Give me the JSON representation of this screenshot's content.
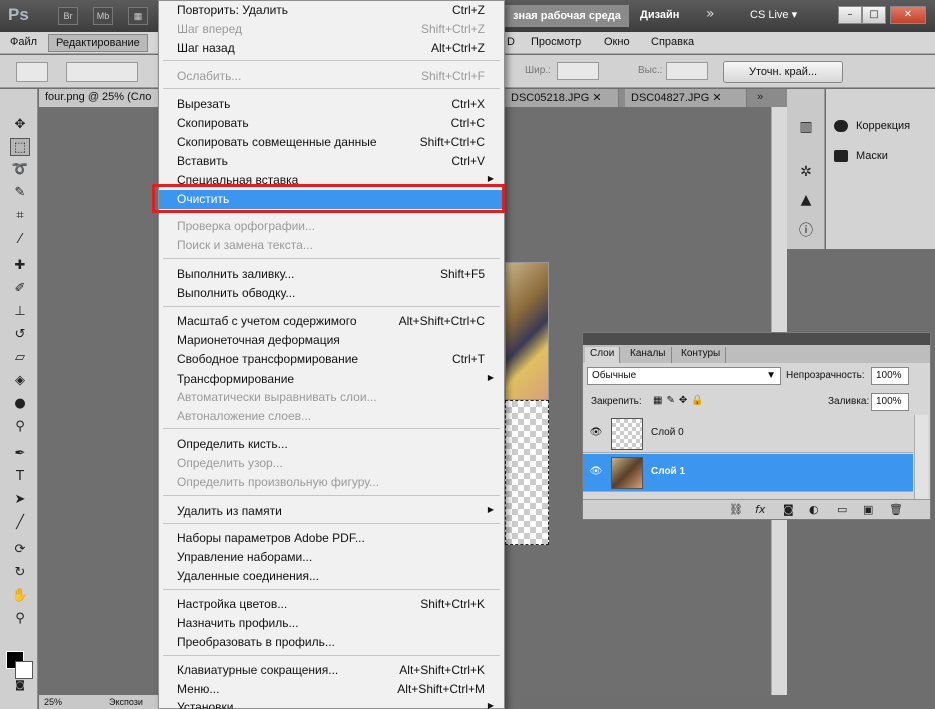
{
  "titlebar": {
    "app_logo": "Ps",
    "buttons": [
      "Br",
      "Mb"
    ],
    "workspace": "зная рабочая среда",
    "design": "Дизайн",
    "cslive": "CS Live"
  },
  "menubar": {
    "items": [
      "Файл",
      "Редактирование",
      "D",
      "Просмотр",
      "Окно",
      "Справка"
    ]
  },
  "options": {
    "width_label": "Шир.:",
    "height_label": "Выс.:",
    "refine_edge": "Уточн. край..."
  },
  "tabs": {
    "active": "four.png @ 25% (Сло",
    "tab2": "DSC05218.JPG",
    "tab3": "DSC04827.JPG"
  },
  "status": {
    "zoom": "25%",
    "exposure": "Экспози"
  },
  "dock": {
    "corrections": "Коррекция",
    "masks": "Маски"
  },
  "layers_panel": {
    "tabs": [
      "Слои",
      "Каналы",
      "Контуры"
    ],
    "blend_mode": "Обычные",
    "opacity_label": "Непрозрачность:",
    "opacity_value": "100%",
    "lock_label": "Закрепить:",
    "fill_label": "Заливка:",
    "fill_value": "100%",
    "layers": [
      {
        "name": "Слой 0",
        "selected": false
      },
      {
        "name": "Слой 1",
        "selected": true
      }
    ]
  },
  "edit_menu": {
    "items": [
      {
        "label": "Повторить: Удалить",
        "shortcut": "Ctrl+Z",
        "disabled": false
      },
      {
        "label": "Шаг вперед",
        "shortcut": "Shift+Ctrl+Z",
        "disabled": true
      },
      {
        "label": "Шаг назад",
        "shortcut": "Alt+Ctrl+Z",
        "disabled": false
      },
      {
        "label": "Ослабить...",
        "shortcut": "Shift+Ctrl+F",
        "disabled": true
      },
      {
        "label": "Вырезать",
        "shortcut": "Ctrl+X",
        "disabled": false
      },
      {
        "label": "Скопировать",
        "shortcut": "Ctrl+C",
        "disabled": false
      },
      {
        "label": "Скопировать совмещенные данные",
        "shortcut": "Shift+Ctrl+C",
        "disabled": false
      },
      {
        "label": "Вставить",
        "shortcut": "Ctrl+V",
        "disabled": false
      },
      {
        "label": "Специальная вставка",
        "shortcut": "",
        "disabled": false,
        "submenu": true
      },
      {
        "label": "Очистить",
        "shortcut": "",
        "disabled": false,
        "highlighted": true
      },
      {
        "label": "Проверка орфографии...",
        "shortcut": "",
        "disabled": true
      },
      {
        "label": "Поиск и замена текста...",
        "shortcut": "",
        "disabled": true
      },
      {
        "label": "Выполнить заливку...",
        "shortcut": "Shift+F5",
        "disabled": false
      },
      {
        "label": "Выполнить обводку...",
        "shortcut": "",
        "disabled": false
      },
      {
        "label": "Масштаб с учетом содержимого",
        "shortcut": "Alt+Shift+Ctrl+C",
        "disabled": false
      },
      {
        "label": "Марионеточная деформация",
        "shortcut": "",
        "disabled": false
      },
      {
        "label": "Свободное трансформирование",
        "shortcut": "Ctrl+T",
        "disabled": false
      },
      {
        "label": "Трансформирование",
        "shortcut": "",
        "disabled": false,
        "submenu": true
      },
      {
        "label": "Автоматически выравнивать слои...",
        "shortcut": "",
        "disabled": true
      },
      {
        "label": "Автоналожение слоев...",
        "shortcut": "",
        "disabled": true
      },
      {
        "label": "Определить кисть...",
        "shortcut": "",
        "disabled": false
      },
      {
        "label": "Определить узор...",
        "shortcut": "",
        "disabled": true
      },
      {
        "label": "Определить произвольную фигуру...",
        "shortcut": "",
        "disabled": true
      },
      {
        "label": "Удалить из памяти",
        "shortcut": "",
        "disabled": false,
        "submenu": true
      },
      {
        "label": "Наборы параметров Adobe PDF...",
        "shortcut": "",
        "disabled": false
      },
      {
        "label": "Управление наборами...",
        "shortcut": "",
        "disabled": false
      },
      {
        "label": "Удаленные соединения...",
        "shortcut": "",
        "disabled": false
      },
      {
        "label": "Настройка цветов...",
        "shortcut": "Shift+Ctrl+K",
        "disabled": false
      },
      {
        "label": "Назначить профиль...",
        "shortcut": "",
        "disabled": false
      },
      {
        "label": "Преобразовать в профиль...",
        "shortcut": "",
        "disabled": false
      },
      {
        "label": "Клавиатурные сокращения...",
        "shortcut": "Alt+Shift+Ctrl+K",
        "disabled": false
      },
      {
        "label": "Меню...",
        "shortcut": "Alt+Shift+Ctrl+M",
        "disabled": false
      },
      {
        "label": "Установки",
        "shortcut": "",
        "disabled": false,
        "submenu": true
      }
    ]
  },
  "colors": {
    "highlight": "#3c95ee",
    "annotation_border": "#e02020"
  }
}
